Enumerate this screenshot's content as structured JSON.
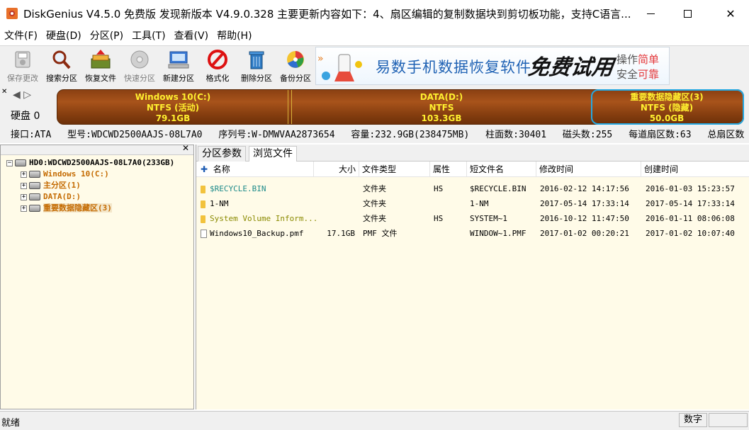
{
  "titlebar": {
    "title": "DiskGenius V4.5.0 免费版  发现新版本 V4.9.0.328 主要更新内容如下：4、扇区编辑的复制数据块到剪切板功能，支持C语言..."
  },
  "menu": [
    "文件(F)",
    "硬盘(D)",
    "分区(P)",
    "工具(T)",
    "查看(V)",
    "帮助(H)"
  ],
  "toolbar": [
    {
      "label": "保存更改",
      "icon": "save-icon",
      "enabled": false
    },
    {
      "label": "搜索分区",
      "icon": "search-icon",
      "enabled": true
    },
    {
      "label": "恢复文件",
      "icon": "recover-icon",
      "enabled": true
    },
    {
      "label": "快速分区",
      "icon": "quick-partition-icon",
      "enabled": false
    },
    {
      "label": "新建分区",
      "icon": "new-partition-icon",
      "enabled": true
    },
    {
      "label": "格式化",
      "icon": "format-icon",
      "enabled": true
    },
    {
      "label": "删除分区",
      "icon": "delete-icon",
      "enabled": true
    },
    {
      "label": "备份分区",
      "icon": "backup-icon",
      "enabled": true
    }
  ],
  "banner": {
    "text": "易数手机数据恢复软件",
    "free": "免费试用",
    "r1a": "操作",
    "r1b": "简单",
    "r2a": "安全",
    "r2b": "可靠"
  },
  "diskmap": {
    "disk_label": "硬盘 0",
    "partitions": [
      {
        "name": "Windows 10(C:)",
        "fs": "NTFS (活动)",
        "size": "79.1GB"
      },
      {
        "name": "DATA(D:)",
        "fs": "NTFS",
        "size": "103.3GB"
      },
      {
        "name": "重要数据隐藏区(3)",
        "fs": "NTFS (隐藏)",
        "size": "50.0GB"
      }
    ]
  },
  "infoline": {
    "iface": "接口:ATA",
    "model": "型号:WDCWD2500AAJS-08L7A0",
    "serial": "序列号:W-DMWVAA2873654",
    "capacity": "容量:232.9GB(238475MB)",
    "cylinders": "柱面数:30401",
    "heads": "磁头数:255",
    "sectors": "每道扇区数:63",
    "total": "总扇区数"
  },
  "tree": {
    "disk": "HD0:WDCWD2500AAJS-08L7A0(233GB)",
    "items": [
      "Windows 10(C:)",
      "主分区(1)",
      "DATA(D:)",
      "重要数据隐藏区(3)"
    ]
  },
  "tabs": [
    "分区参数",
    "浏览文件"
  ],
  "columns": [
    "名称",
    "大小",
    "文件类型",
    "属性",
    "短文件名",
    "修改时间",
    "创建时间"
  ],
  "files": [
    {
      "name": "$RECYCLE.BIN",
      "size": "",
      "type": "文件夹",
      "attr": "HS",
      "short": "$RECYCLE.BIN",
      "mtime": "2016-02-12 14:17:56",
      "ctime": "2016-01-03 15:23:57"
    },
    {
      "name": "1-NM",
      "size": "",
      "type": "文件夹",
      "attr": "",
      "short": "1-NM",
      "mtime": "2017-05-14 17:33:14",
      "ctime": "2017-05-14 17:33:14"
    },
    {
      "name": "System Volume Inform...",
      "size": "",
      "type": "文件夹",
      "attr": "HS",
      "short": "SYSTEM~1",
      "mtime": "2016-10-12 11:47:50",
      "ctime": "2016-01-11 08:06:08"
    },
    {
      "name": "Windows10_Backup.pmf",
      "size": "17.1GB",
      "type": "PMF 文件",
      "attr": "",
      "short": "WINDOW~1.PMF",
      "mtime": "2017-01-02 00:20:21",
      "ctime": "2017-01-02 10:07:40"
    }
  ],
  "status": {
    "left": "就绪",
    "num": "数字"
  }
}
